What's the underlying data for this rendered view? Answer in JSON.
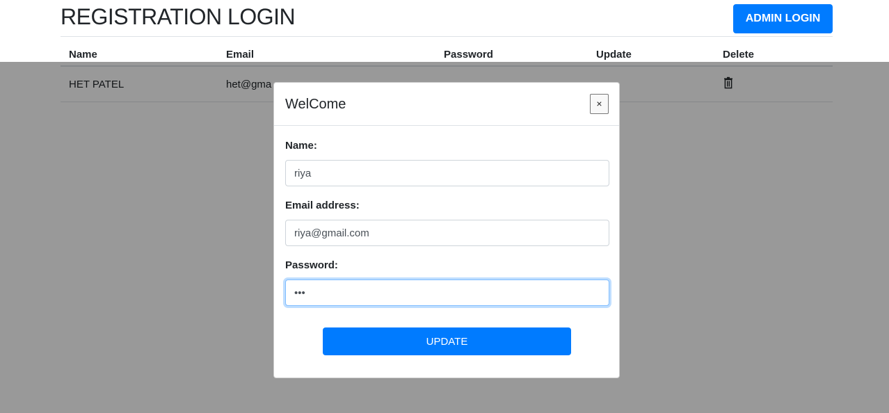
{
  "header": {
    "title": "REGISTRATION LOGIN",
    "admin_login_label": "ADMIN LOGIN"
  },
  "table": {
    "columns": [
      "Name",
      "Email",
      "Password",
      "Update",
      "Delete"
    ],
    "rows": [
      {
        "name": "HET PATEL",
        "email": "het@gma",
        "password": "",
        "delete_icon": "trash-icon"
      }
    ]
  },
  "modal": {
    "title": "WelCome",
    "close_label": "×",
    "name_label": "Name:",
    "name_value": "riya",
    "email_label": "Email address:",
    "email_value": "riya@gmail.com",
    "password_label": "Password:",
    "password_value": "123",
    "update_label": "UPDATE"
  },
  "colors": {
    "primary": "#007bff",
    "backdrop": "rgba(0,0,0,0.4)"
  }
}
